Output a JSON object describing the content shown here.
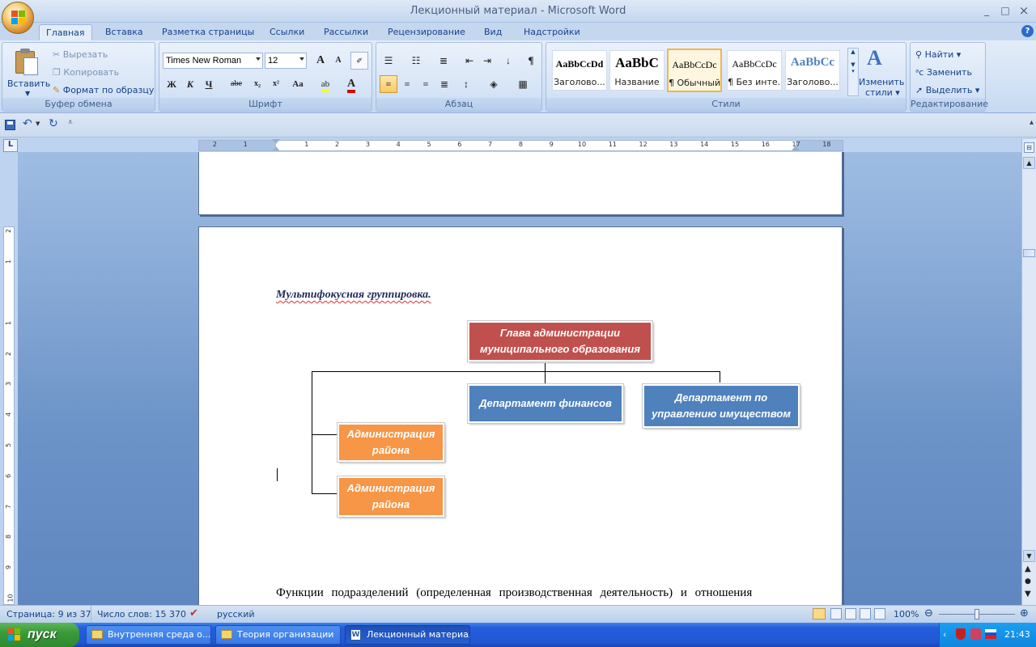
{
  "window": {
    "title": "Лекционный материал - Microsoft Word",
    "min": "_",
    "max": "□",
    "close": "×",
    "help": "?"
  },
  "tabs": [
    "Главная",
    "Вставка",
    "Разметка страницы",
    "Ссылки",
    "Рассылки",
    "Рецензирование",
    "Вид",
    "Надстройки"
  ],
  "clipboard": {
    "paste": "Вставить",
    "cut": "Вырезать",
    "copy": "Копировать",
    "format_painter": "Формат по образцу",
    "title": "Буфер обмена"
  },
  "font": {
    "name": "Times New Roman",
    "size": "12",
    "title": "Шрифт",
    "bold": "Ж",
    "italic": "К",
    "underline": "Ч",
    "strike": "abe",
    "subscript": "x₂",
    "superscript": "x²",
    "case": "Aa",
    "grow": "A",
    "shrink": "A"
  },
  "paragraph": {
    "title": "Абзац"
  },
  "styles": {
    "title": "Стили",
    "items": [
      {
        "sample": "AaBbCcDd",
        "name": "Заголово..."
      },
      {
        "sample": "AaBbC",
        "name": "Название"
      },
      {
        "sample": "AaBbCcDc",
        "name": "¶ Обычный"
      },
      {
        "sample": "AaBbCcDc",
        "name": "¶ Без инте..."
      },
      {
        "sample": "AaBbCc",
        "name": "Заголово..."
      }
    ],
    "change": "Изменить",
    "change2": "стили"
  },
  "editing": {
    "title": "Редактирование",
    "find": "Найти",
    "replace": "Заменить",
    "select": "Выделить"
  },
  "ruler": {
    "corner": "L",
    "h_ticks": [
      "2",
      "1",
      "1",
      "2",
      "3",
      "4",
      "5",
      "6",
      "7",
      "8",
      "9",
      "10",
      "11",
      "12",
      "13",
      "14",
      "15",
      "16",
      "17",
      "18"
    ],
    "v_ticks": [
      "2",
      "1",
      "1",
      "2",
      "3",
      "4",
      "5",
      "6",
      "7",
      "8",
      "9",
      "10"
    ]
  },
  "document": {
    "heading": "Мультифокусная группировка.",
    "chart": {
      "head": "Глава администрации муниципального образования",
      "finance": "Департамент финансов",
      "property": "Департамент по управлению имуществом",
      "district1": "Администрация района",
      "district2": "Администрация района"
    },
    "paragraph": "Функции подразделений (определенная производственная деятельность) и отношения"
  },
  "statusbar": {
    "page": "Страница: 9 из 37",
    "words": "Число слов: 15 370",
    "language": "русский",
    "zoom": "100%"
  },
  "taskbar": {
    "start": "пуск",
    "tasks": [
      "Внутренняя среда о...",
      "Теория организации",
      "Лекционный материал..."
    ],
    "time": "21:43"
  },
  "colors": {
    "head_box": "#c0504d",
    "dept_box": "#4f81bd",
    "district_box": "#f79646"
  }
}
